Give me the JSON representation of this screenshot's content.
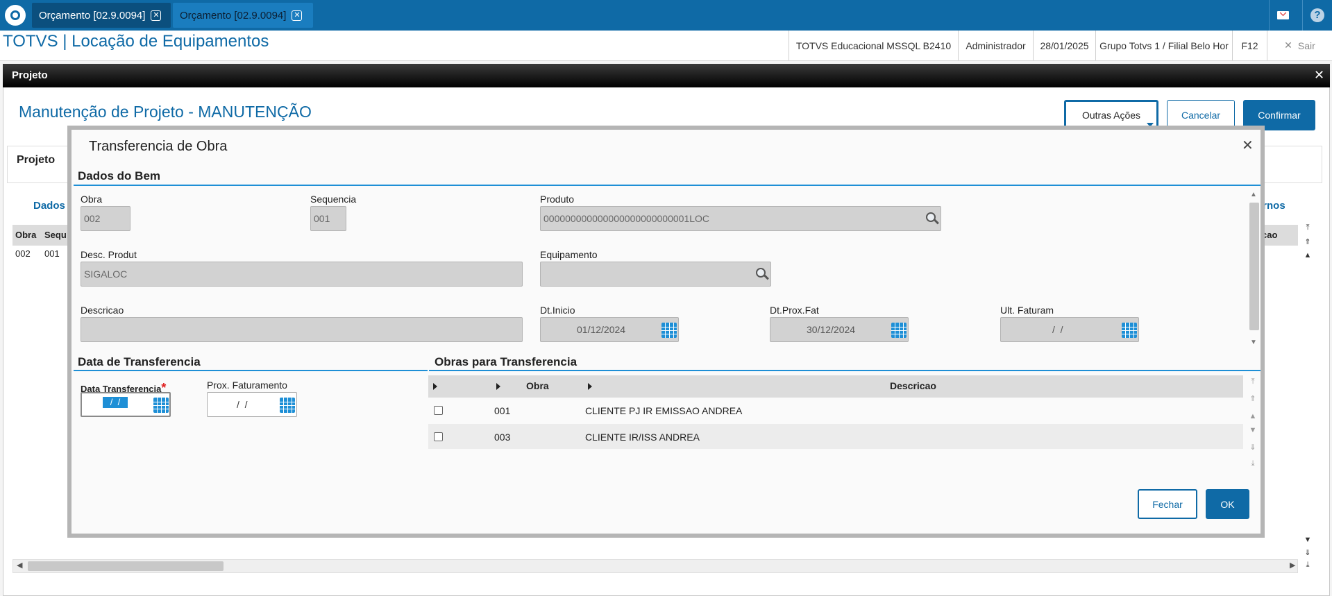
{
  "tabs": [
    {
      "label": "Orçamento [02.9.0094]"
    },
    {
      "label": "Orçamento [02.9.0094]"
    }
  ],
  "app": {
    "title": "TOTVS | Locação de Equipamentos",
    "environment": "TOTVS Educacional MSSQL B2410",
    "user": "Administrador",
    "date": "28/01/2025",
    "branch": "Grupo Totvs 1 / Filial Belo Hor",
    "f12": "F12",
    "exit": "Sair"
  },
  "window": {
    "title": "Projeto",
    "page_title": "Manutenção de Projeto - MANUTENÇÃO",
    "buttons": {
      "outras_acoes": "Outras Ações",
      "cancelar": "Cancelar",
      "confirmar": "Confirmar"
    },
    "projeto_label": "Projeto",
    "folder_dados": "Dados",
    "folder_turnos": "urnos",
    "grid_headers": [
      "Obra",
      "Sequ",
      "cao"
    ],
    "grid_row": [
      "002",
      "001"
    ]
  },
  "modal": {
    "title": "Transferencia de Obra",
    "section_bem": "Dados do Bem",
    "fields": {
      "obra": {
        "label": "Obra",
        "value": "002"
      },
      "sequencia": {
        "label": "Sequencia",
        "value": "001"
      },
      "produto": {
        "label": "Produto",
        "value": "000000000000000000000000001LOC"
      },
      "desc_produt": {
        "label": "Desc. Produt",
        "value": "SIGALOC"
      },
      "equipamento": {
        "label": "Equipamento",
        "value": ""
      },
      "descricao": {
        "label": "Descricao",
        "value": ""
      },
      "dt_inicio": {
        "label": "Dt.Inicio",
        "value": "01/12/2024"
      },
      "dt_prox_fat": {
        "label": "Dt.Prox.Fat",
        "value": "30/12/2024"
      },
      "ult_faturam": {
        "label": "Ult. Faturam",
        "value": "/  /"
      }
    },
    "section_data": "Data de Transferencia",
    "data_transferencia": {
      "label": "Data Transferencia",
      "required": "*",
      "value": "/  /"
    },
    "prox_faturamento": {
      "label": "Prox. Faturamento",
      "value": "/  /"
    },
    "section_obras": "Obras para Transferencia",
    "obras_grid": {
      "headers": {
        "obra": "Obra",
        "descricao": "Descricao"
      },
      "rows": [
        {
          "obra": "001",
          "descricao": "CLIENTE PJ IR EMISSAO ANDREA"
        },
        {
          "obra": "003",
          "descricao": "CLIENTE IR/ISS ANDREA"
        }
      ]
    },
    "buttons": {
      "fechar": "Fechar",
      "ok": "OK"
    }
  },
  "colors": {
    "brand": "#0f6aa6",
    "accent": "#1e8fd6",
    "required": "#e02020"
  }
}
